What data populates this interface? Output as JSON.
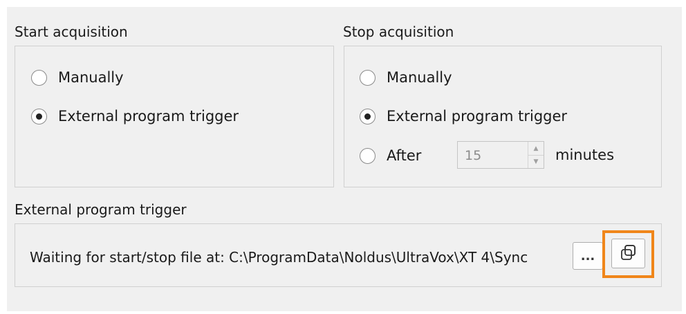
{
  "start_acquisition": {
    "title": "Start acquisition",
    "options": [
      {
        "label": "Manually",
        "checked": false
      },
      {
        "label": "External program trigger",
        "checked": true
      }
    ]
  },
  "stop_acquisition": {
    "title": "Stop acquisition",
    "options": [
      {
        "label": "Manually",
        "checked": false
      },
      {
        "label": "External program trigger",
        "checked": true
      },
      {
        "label": "After",
        "checked": false
      }
    ],
    "minutes_value": "15",
    "minutes_unit": "minutes"
  },
  "external_trigger": {
    "title": "External program trigger",
    "status_text": "Waiting for start/stop file at: C:\\ProgramData\\Noldus\\UltraVox\\XT 4\\Sync",
    "browse_label": "...",
    "copy_icon": "copy-icon"
  },
  "colors": {
    "highlight": "#f0861a",
    "panel_background": "#f0f0f0"
  }
}
